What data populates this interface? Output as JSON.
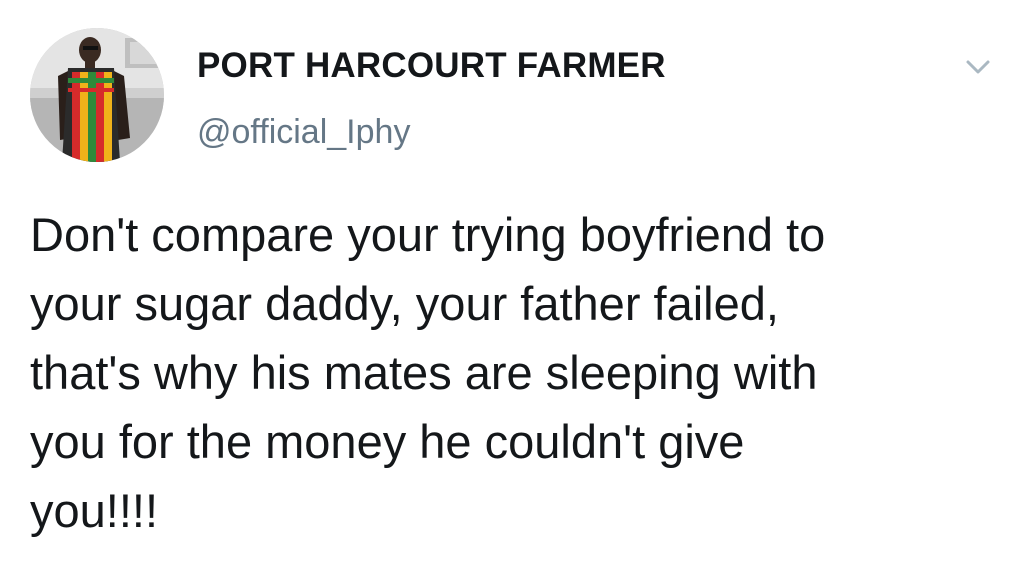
{
  "tweet": {
    "display_name": "PORT HARCOURT FARMER",
    "handle": "@official_Iphy",
    "text_lines": [
      "Don't compare your trying boyfriend to",
      "your sugar daddy, your father failed,",
      "that's why his mates are sleeping with",
      "you for the money he couldn't give",
      "you!!!!"
    ]
  },
  "icons": {
    "caret": "chevron-down-icon",
    "avatar": "profile-photo"
  },
  "colors": {
    "name": "#14171a",
    "handle": "#657786",
    "text": "#14171a",
    "caret": "#aab8c2"
  }
}
